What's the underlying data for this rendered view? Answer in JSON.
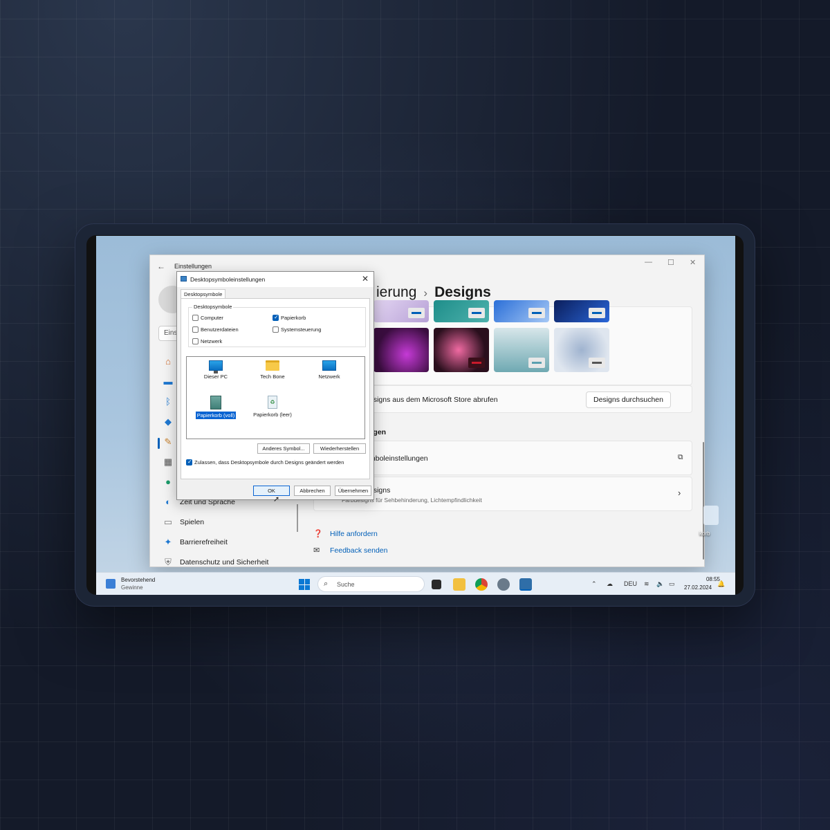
{
  "settings": {
    "title": "Einstellungen",
    "search_stub": "Eins",
    "breadcrumb_prev": "ierung",
    "breadcrumb_current": "Designs",
    "store_text": "esigns aus dem Microsoft Store abrufen",
    "browse_button": "Designs durchsuchen",
    "section_related": "ngen",
    "desktop_icons_row": "mboleinstellungen",
    "contrast_title": "esigns",
    "contrast_sub": "Farbdesigns für Sehbehinderung, Lichtempfindlichkeit",
    "help_link": "Hilfe anfordern",
    "feedback_link": "Feedback senden",
    "nav": [
      {
        "label": "Zeit und Sprache"
      },
      {
        "label": "Spielen"
      },
      {
        "label": "Barrierefreiheit"
      },
      {
        "label": "Datenschutz und Sicherheit"
      }
    ]
  },
  "dialog": {
    "title": "Desktopsymboleinstellungen",
    "tab": "Desktopsymbole",
    "group_label": "Desktopsymbole",
    "checkboxes": [
      {
        "label": "Computer",
        "checked": false
      },
      {
        "label": "Papierkorb",
        "checked": true
      },
      {
        "label": "Benutzerdateien",
        "checked": false
      },
      {
        "label": "Systemsteuerung",
        "checked": false
      },
      {
        "label": "Netzwerk",
        "checked": false
      }
    ],
    "icons": [
      {
        "label": "Dieser PC"
      },
      {
        "label": "Tech Bone"
      },
      {
        "label": "Netzwerk"
      },
      {
        "label": "Papierkorb (voll)"
      },
      {
        "label": "Papierkorb (leer)"
      }
    ],
    "other_icon_button": "Anderes Symbol...",
    "restore_button": "Wiederherstellen",
    "allow_themes": "Zulassen, dass Desktopsymbole durch Designs geändert werden",
    "allow_themes_checked": true,
    "ok": "OK",
    "cancel": "Abbrechen",
    "apply": "Übernehmen"
  },
  "desktop": {
    "bin_label": "korb"
  },
  "taskbar": {
    "weather_title": "Bevorstehend",
    "weather_sub": "Gewinne",
    "search_placeholder": "Suche",
    "language": "DEU",
    "time": "08:55",
    "date": "27.02.2024"
  },
  "colors": {
    "accent": "#005fb8",
    "selection": "#0a64d2"
  }
}
